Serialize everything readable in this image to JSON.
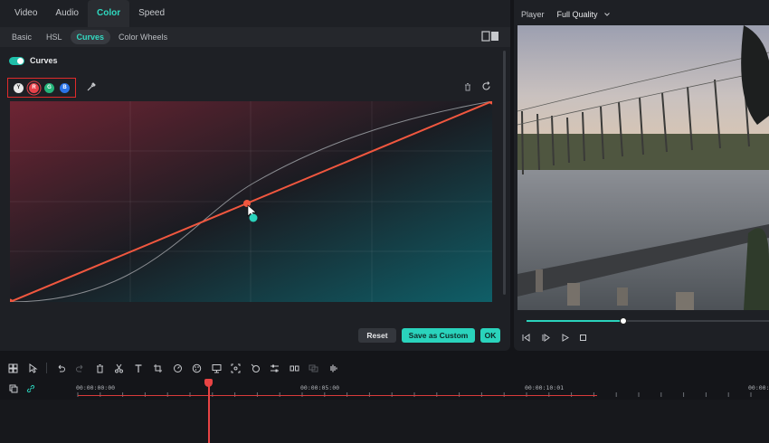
{
  "panel": {
    "tabs": [
      {
        "label": "Video"
      },
      {
        "label": "Audio"
      },
      {
        "label": "Color"
      },
      {
        "label": "Speed"
      }
    ],
    "subtabs": [
      {
        "label": "Basic"
      },
      {
        "label": "HSL"
      },
      {
        "label": "Curves"
      },
      {
        "label": "Color Wheels"
      }
    ],
    "curves_label": "Curves",
    "channels": [
      {
        "label": "Y"
      },
      {
        "label": "R"
      },
      {
        "label": "G"
      },
      {
        "label": "B"
      }
    ],
    "buttons": {
      "reset": "Reset",
      "save": "Save as Custom",
      "ok": "OK"
    }
  },
  "player": {
    "label": "Player",
    "quality": "Full Quality",
    "progress": 0.4
  },
  "timeline": {
    "timestamps": [
      "00:00:00:00",
      "00:00:05:00",
      "00:00:10:01",
      "00:00:1"
    ]
  },
  "colors": {
    "accent": "#2ad3bc",
    "red_channel": "#f0573f",
    "highlight_box": "#e02b2b"
  }
}
